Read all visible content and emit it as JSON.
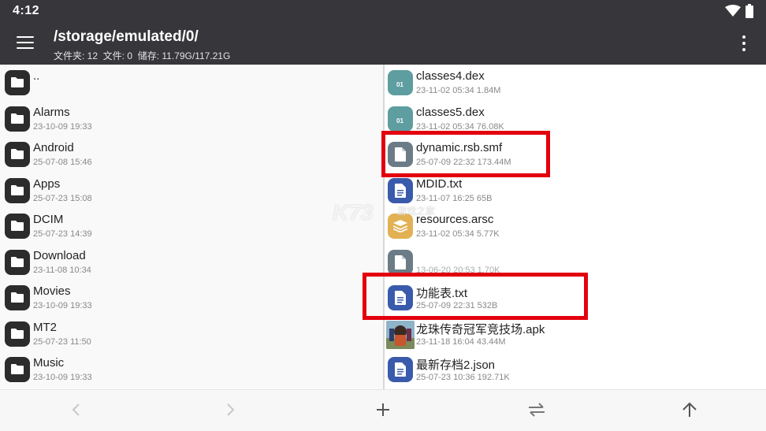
{
  "status_bar": {
    "time": "4:12"
  },
  "toolbar": {
    "path": "/storage/emulated/0/",
    "info": "文件夹: 12  文件: 0  储存: 11.79G/117.21G"
  },
  "left_pane": {
    "items": [
      {
        "name": "..",
        "meta": ""
      },
      {
        "name": "Alarms",
        "meta": "23-10-09 19:33"
      },
      {
        "name": "Android",
        "meta": "25-07-08 15:46"
      },
      {
        "name": "Apps",
        "meta": "25-07-23 15:08"
      },
      {
        "name": "DCIM",
        "meta": "25-07-23 14:39"
      },
      {
        "name": "Download",
        "meta": "23-11-08 10:34"
      },
      {
        "name": "Movies",
        "meta": "23-10-09 19:33"
      },
      {
        "name": "MT2",
        "meta": "25-07-23 11:50"
      },
      {
        "name": "Music",
        "meta": "23-10-09 19:33"
      }
    ]
  },
  "right_pane": {
    "items": [
      {
        "name": "classes4.dex",
        "meta": "23-11-02 05:34  1.84M",
        "icon": "dex-file-icon"
      },
      {
        "name": "classes5.dex",
        "meta": "23-11-02 05:34  76.08K",
        "icon": "dex-file-icon"
      },
      {
        "name": "dynamic.rsb.smf",
        "meta": "25-07-09 22:32  173.44M",
        "icon": "generic-file-icon"
      },
      {
        "name": "MDID.txt",
        "meta": "23-11-07 16:25  65B",
        "icon": "text-file-icon"
      },
      {
        "name": "resources.arsc",
        "meta": "23-11-02 05:34  5.77K",
        "icon": "arsc-file-icon"
      },
      {
        "name": "",
        "meta": "13-06-20 20:53  1.70K",
        "icon": "generic-file-icon"
      },
      {
        "name": "功能表.txt",
        "meta": "25-07-09 22:31  532B",
        "icon": "text-file-icon"
      },
      {
        "name": "龙珠传奇冠军竞技场.apk",
        "meta": "23-11-18 16:04  43.44M",
        "icon": "apk-thumbnail"
      },
      {
        "name": "最新存档2.json",
        "meta": "25-07-23 10:36  192.71K",
        "icon": "text-file-icon"
      }
    ],
    "dex_badge": "01"
  },
  "watermark": {
    "brand": "K73",
    "subtitle": "游戏之家"
  },
  "colors": {
    "appbar": "#37363a",
    "folder_icon": "#2c2c2c",
    "dex_icon": "#5e9ea0",
    "text_icon": "#3a5bab",
    "arsc_icon": "#e2b154",
    "generic_icon": "#6b7c86",
    "highlight": "#e3000e"
  }
}
